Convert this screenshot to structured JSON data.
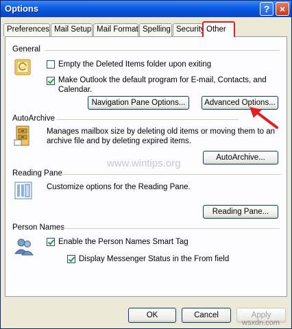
{
  "window": {
    "title": "Options",
    "help_label": "?",
    "close_label": "×"
  },
  "tabs": [
    {
      "label": "Preferences"
    },
    {
      "label": "Mail Setup"
    },
    {
      "label": "Mail Format"
    },
    {
      "label": "Spelling"
    },
    {
      "label": "Security"
    },
    {
      "label": "Other",
      "active": true
    }
  ],
  "general": {
    "title": "General",
    "empty_deleted": {
      "label": "Empty the Deleted Items folder upon exiting",
      "checked": false
    },
    "default_program": {
      "label_line1": "Make Outlook the default program for E-mail, Contacts, and",
      "label_line2": "Calendar.",
      "checked": true
    },
    "nav_pane_button": "Navigation Pane Options...",
    "advanced_button": "Advanced Options..."
  },
  "autoarchive": {
    "title": "AutoArchive",
    "description_line1": "Manages mailbox size by deleting old items or moving them to an",
    "description_line2": "archive file and by deleting expired items.",
    "button": "AutoArchive..."
  },
  "reading_pane": {
    "title": "Reading Pane",
    "description": "Customize options for the Reading Pane.",
    "button": "Reading Pane..."
  },
  "person_names": {
    "title": "Person Names",
    "smart_tag": {
      "label": "Enable the Person Names Smart Tag",
      "checked": true
    },
    "messenger_status": {
      "label": "Display Messenger Status in the From field",
      "checked": true
    }
  },
  "footer": {
    "ok": "OK",
    "cancel": "Cancel",
    "apply": "Apply"
  },
  "watermark": "www.wintips.org",
  "corner_mark": "wsxdn.com",
  "colors": {
    "highlight": "#e02020",
    "titlebar": "#0a4fd6"
  }
}
